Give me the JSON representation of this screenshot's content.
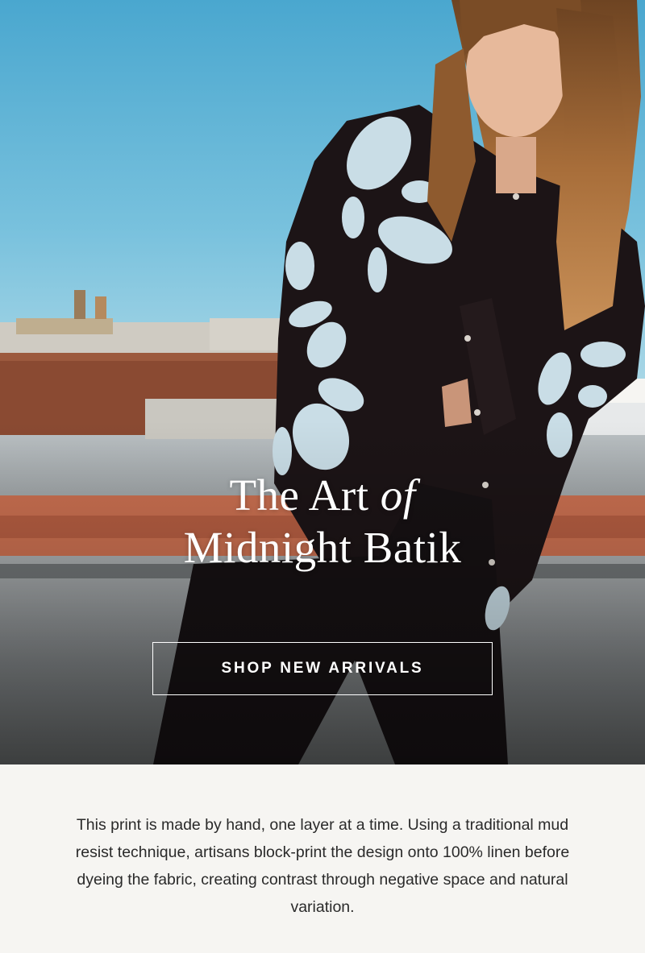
{
  "hero": {
    "headline_line1_prefix": "The Art ",
    "headline_line1_italic": "of",
    "headline_line2": "Midnight Batik",
    "cta_label": "SHOP NEW ARRIVALS"
  },
  "story": {
    "body": "This print is made by hand, one layer at a time. Using a traditional mud resist technique, artisans block-print the design onto 100% linen before dyeing the fabric, creating contrast through negative space and natural variation."
  },
  "colors": {
    "sky": "#5fb4d6",
    "garment": "#1c1416",
    "batik_print": "#c9dde6",
    "page_background": "#f6f5f2",
    "text": "#2a2a2a"
  }
}
